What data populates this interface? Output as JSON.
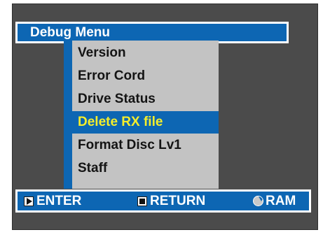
{
  "title": "Debug Menu",
  "menu": {
    "items": [
      {
        "label": "Version"
      },
      {
        "label": "Error Cord"
      },
      {
        "label": "Drive Status"
      },
      {
        "label": "Delete RX file",
        "selected": true
      },
      {
        "label": "Format Disc Lv1"
      },
      {
        "label": "Staff"
      }
    ]
  },
  "footer": {
    "enter_label": "ENTER",
    "return_label": "RETURN",
    "ram_label": "RAM"
  },
  "colors": {
    "background": "#4b4b4b",
    "accent": "#0d66b3",
    "menu_bg": "#c3c3c3",
    "selected_text": "#f5ee2b",
    "text_dark": "#141414",
    "text_light": "#ffffff"
  },
  "icons": {
    "enter": "play-icon",
    "return": "stop-icon",
    "ram": "disc-icon"
  }
}
